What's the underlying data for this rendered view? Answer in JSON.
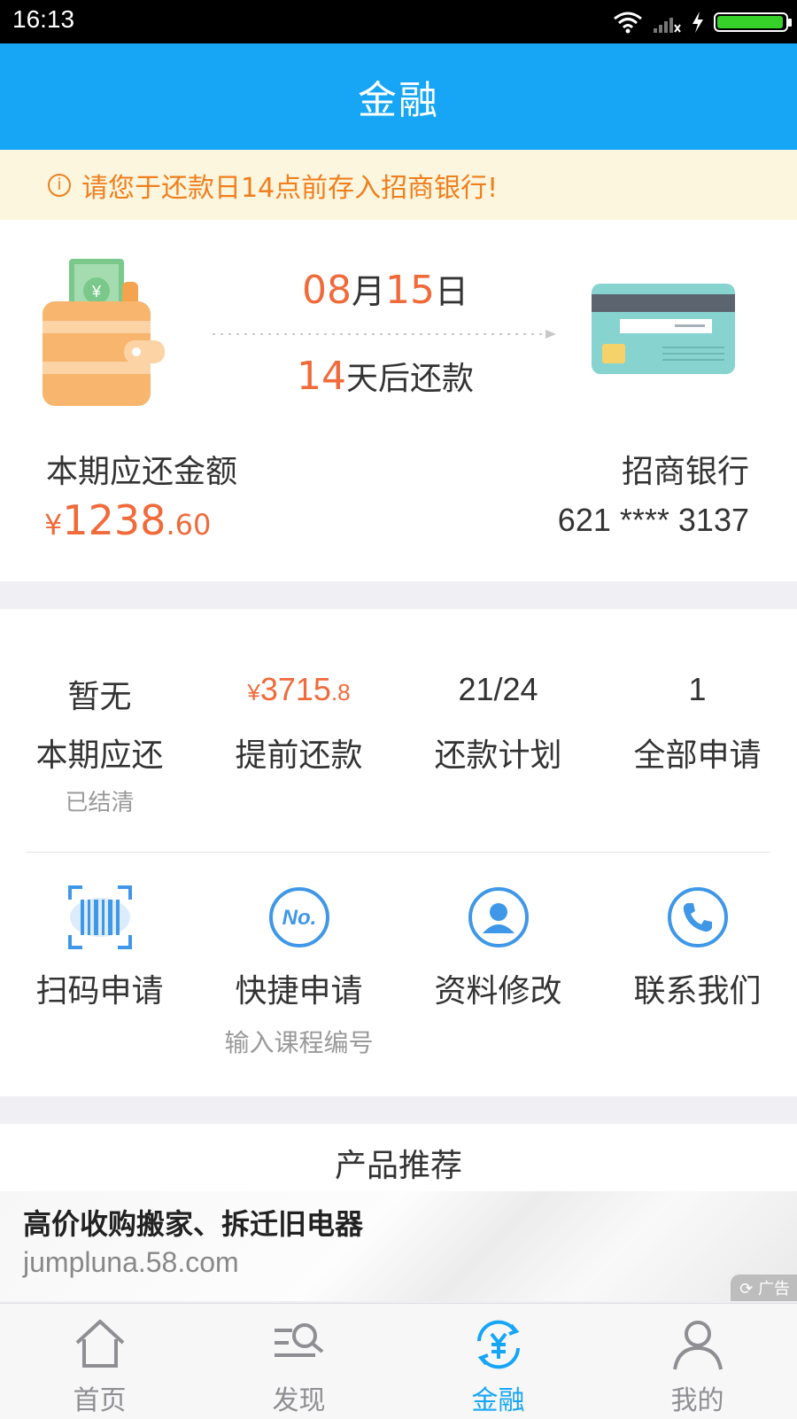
{
  "status_bar": {
    "time": "16:13"
  },
  "header": {
    "title": "金融"
  },
  "notice": {
    "text": "请您于还款日14点前存入招商银行!"
  },
  "repayment": {
    "month": "08",
    "month_unit": "月",
    "day": "15",
    "day_unit": "日",
    "days_left": "14",
    "days_left_suffix": "天后还款",
    "due_label": "本期应还金额",
    "due_currency": "¥",
    "due_int": "1238",
    "due_dec": ".60",
    "bank_name": "招商银行",
    "bank_card": "621 **** 3137"
  },
  "stats": [
    {
      "value": "暂无",
      "label": "本期应还",
      "sub": "已结清"
    },
    {
      "value_cur": "¥",
      "value_int": "3715",
      "value_dec": ".8",
      "label": "提前还款"
    },
    {
      "value": "21/24",
      "label": "还款计划"
    },
    {
      "value": "1",
      "label": "全部申请"
    }
  ],
  "actions": [
    {
      "label": "扫码申请",
      "icon": "barcode-scan-icon"
    },
    {
      "label": "快捷申请",
      "sub": "输入课程编号",
      "icon": "number-icon",
      "icon_text": "No."
    },
    {
      "label": "资料修改",
      "icon": "user-icon"
    },
    {
      "label": "联系我们",
      "icon": "phone-icon"
    }
  ],
  "products": {
    "heading": "产品推荐",
    "ad_title": "高价收购搬家、拆迁旧电器",
    "ad_url": "jumpluna.58.com",
    "ad_badge": "广告"
  },
  "tabbar": [
    {
      "label": "首页",
      "icon": "home-icon"
    },
    {
      "label": "发现",
      "icon": "discover-icon"
    },
    {
      "label": "金融",
      "icon": "finance-icon",
      "active": true
    },
    {
      "label": "我的",
      "icon": "profile-icon"
    }
  ],
  "colors": {
    "primary": "#17a6f6",
    "accent": "#f06a3a",
    "notice": "#f07f1d"
  }
}
